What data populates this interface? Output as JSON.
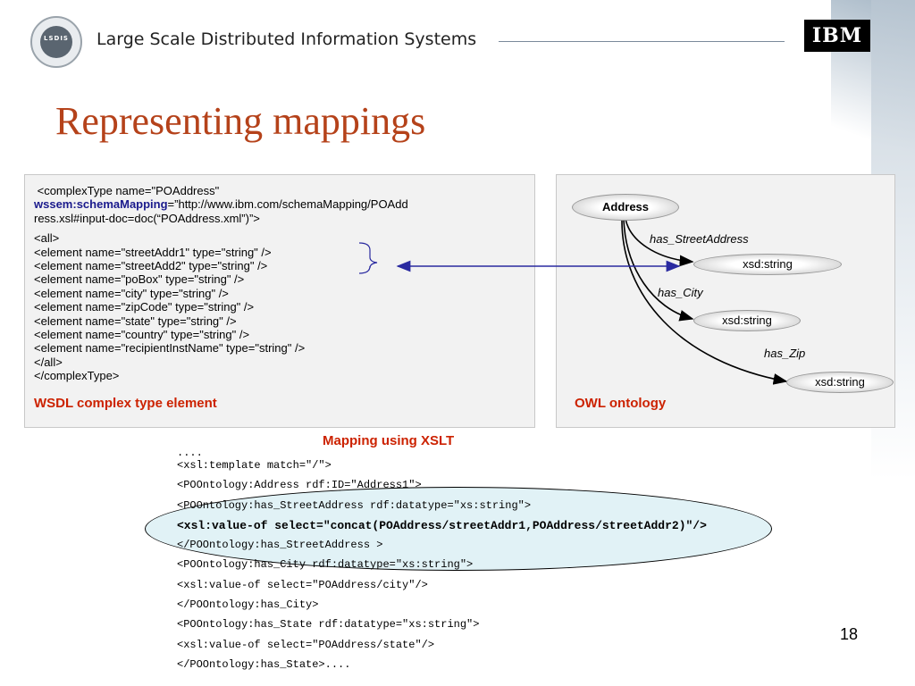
{
  "header": {
    "logo_text": "LSDIS",
    "title": "Large Scale Distributed Information Systems",
    "brand": "IBM"
  },
  "slide": {
    "title": "Representing mappings",
    "page_number": "18"
  },
  "wsdl": {
    "line1": " <complexType name=\"POAddress\"",
    "attr_name": "wssem:schemaMapping",
    "line2_rest": "=”http://www.ibm.com/schemaMapping/POAdd",
    "line3": "ress.xsl#input-doc=doc(“POAddress.xml”)”>",
    "body": [
      "<all>",
      "<element name=\"streetAddr1\" type=\"string\" />",
      "<element name=\"streetAdd2\" type=\"string\" />",
      "<element name=\"poBox\" type=\"string\" />",
      "<element name=\"city\" type=\"string\" />",
      "<element name=\"zipCode\" type=\"string\" />",
      "<element name=\"state\" type=\"string\" />",
      "<element name=\"country\" type=\"string\" />",
      "<element name=\"recipientInstName\" type=\"string\" />",
      "</all>",
      "</complexType>"
    ],
    "caption": "WSDL complex type element"
  },
  "owl": {
    "root": "Address",
    "edges": [
      "has_StreetAddress",
      "has_City",
      "has_Zip"
    ],
    "targets": [
      "xsd:string",
      "xsd:string",
      "xsd:string"
    ],
    "caption": "OWL ontology"
  },
  "xslt": {
    "caption": "Mapping using XSLT",
    "lines": [
      "....",
      "<xsl:template match=\"/\">",
      "<POOntology:Address rdf:ID=\"Address1\">",
      "<POOntology:has_StreetAddress rdf:datatype=\"xs:string\">",
      "<xsl:value-of select=\"concat(POAddress/streetAddr1,POAddress/streetAddr2)\"/>",
      "</POOntology:has_StreetAddress >",
      "<POOntology:has_City rdf:datatype=\"xs:string\">",
      "<xsl:value-of select=\"POAddress/city\"/>",
      "</POOntology:has_City>",
      "<POOntology:has_State rdf:datatype=\"xs:string\">",
      "<xsl:value-of select=\"POAddress/state\"/>",
      "</POOntology:has_State>...."
    ]
  }
}
